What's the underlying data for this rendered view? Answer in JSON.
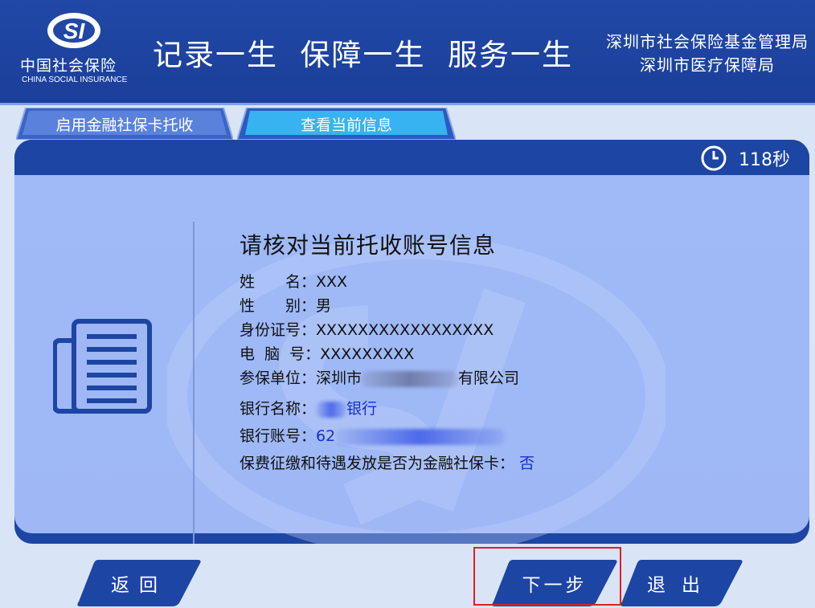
{
  "header": {
    "logo_mark": "SI",
    "logo_cn": "中国社会保险",
    "logo_en": "CHINA SOCIAL INSURANCE",
    "slogan": "记录一生  保障一生  服务一生",
    "org_line1": "深圳市社会保险基金管理局",
    "org_line2": "深圳市医疗保障局"
  },
  "tabs": [
    {
      "label": "启用金融社保卡托收"
    },
    {
      "label": "查看当前信息"
    }
  ],
  "timer": {
    "label": "118秒"
  },
  "info": {
    "title": "请核对当前托收账号信息",
    "name_label": "姓　　名：",
    "name_value": "XXX",
    "gender_label": "性　　别：",
    "gender_value": "男",
    "id_label": "身份证号：",
    "id_value": "XXXXXXXXXXXXXXXXX",
    "pc_label": "电  脑  号：",
    "pc_value": "XXXXXXXXX",
    "employer_label": "参保单位：",
    "employer_prefix": "深圳市",
    "employer_suffix": "有限公司",
    "bank_name_label": "银行名称：",
    "bank_name_suffix": "银行",
    "bank_account_label": "银行账号：",
    "bank_account_prefix": "62",
    "card_label": "保费征缴和待遇发放是否为金融社保卡：",
    "card_value": "否"
  },
  "buttons": {
    "back": "返回",
    "next": "下一步",
    "exit": "退出"
  },
  "colors": {
    "primary": "#1d45a3",
    "highlight": "#e02020",
    "link": "#1430c9"
  }
}
